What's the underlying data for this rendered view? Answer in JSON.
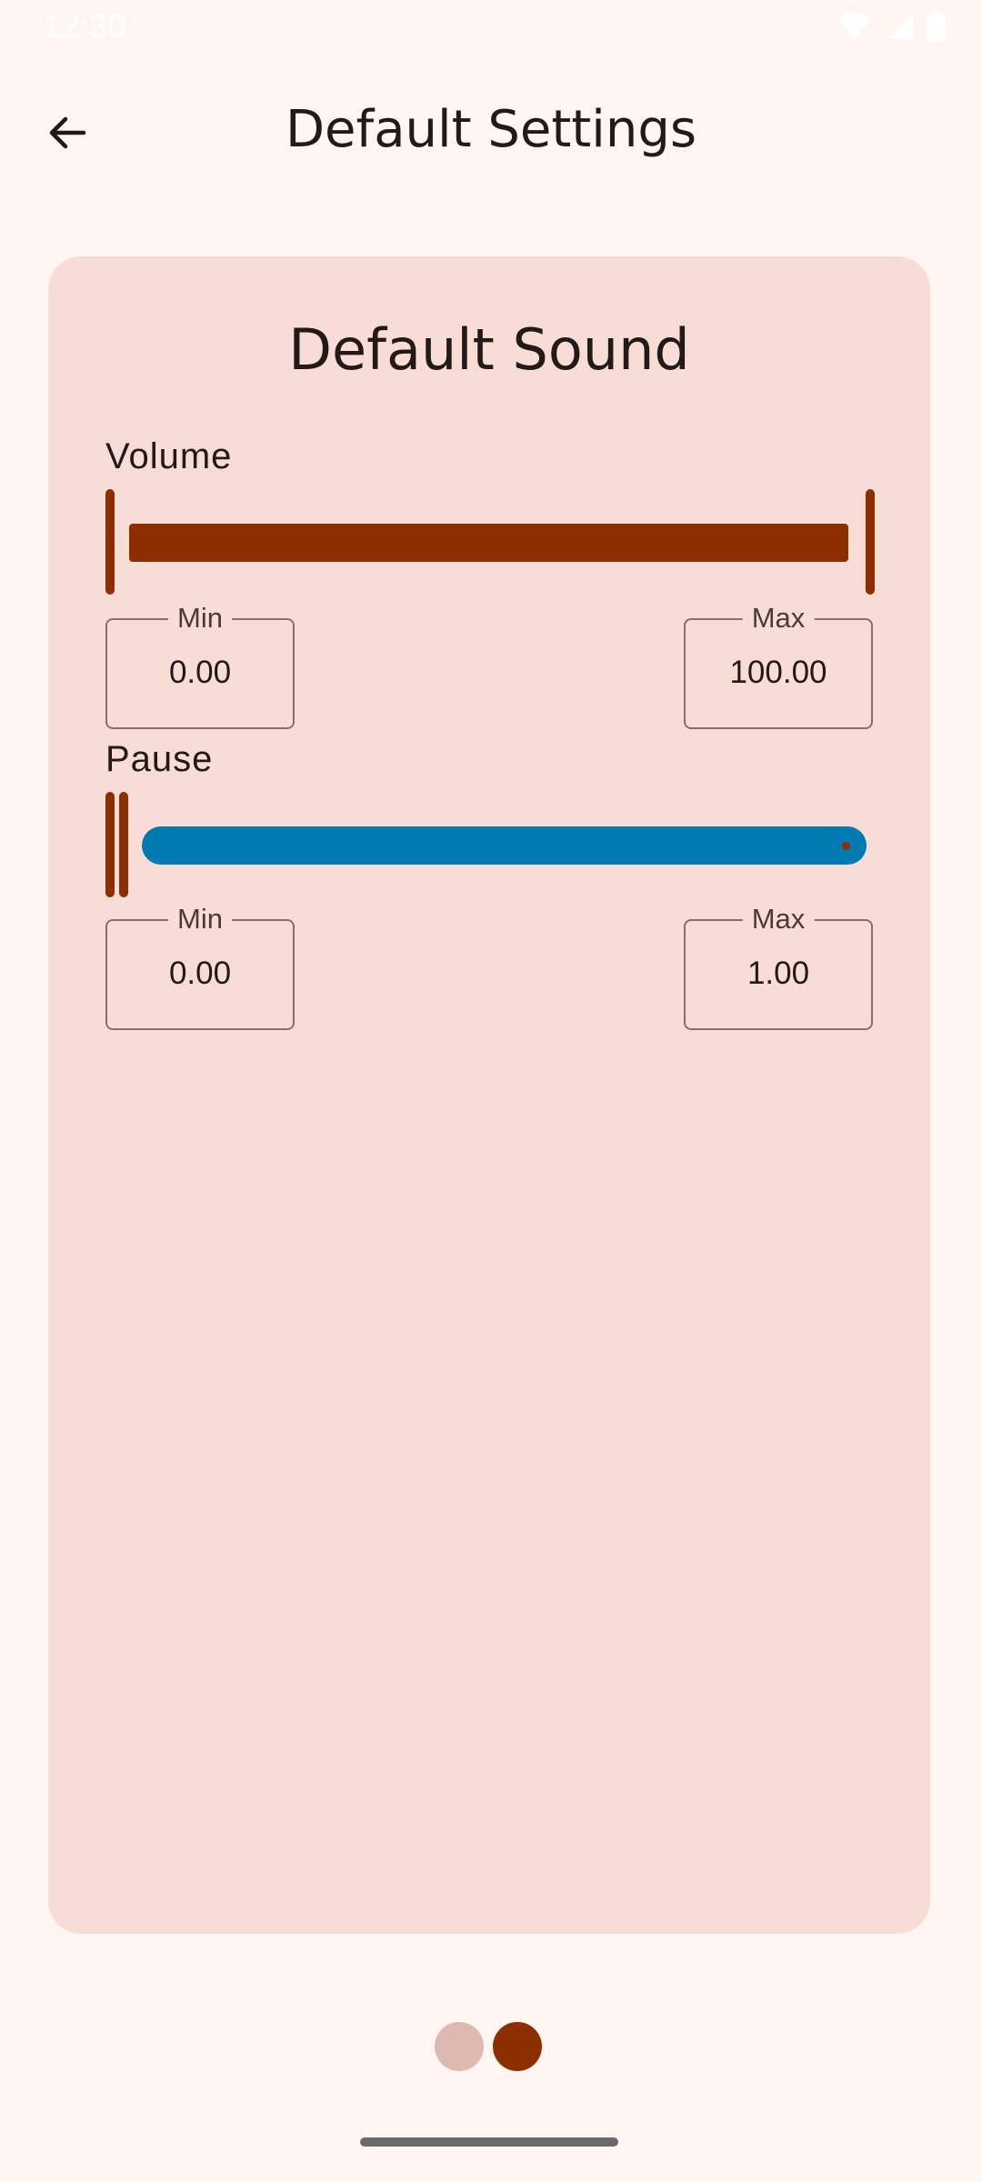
{
  "status_bar": {
    "time": "12:30"
  },
  "header": {
    "title": "Default Settings",
    "back_icon": "arrow-back-icon"
  },
  "card": {
    "title": "Default Sound",
    "volume": {
      "label": "Volume",
      "min_label": "Min",
      "min_value": "0.00",
      "max_label": "Max",
      "max_value": "100.00"
    },
    "pause": {
      "label": "Pause",
      "min_label": "Min",
      "min_value": "0.00",
      "max_label": "Max",
      "max_value": "1.00"
    }
  },
  "pager": {
    "count": 2,
    "active_index": 1
  },
  "colors": {
    "background": "#FFF5F3",
    "card": "#F8DDD6",
    "accent": "#8C2E00",
    "pause_track": "#007BB2",
    "dot_inactive": "#DDB9AF"
  }
}
